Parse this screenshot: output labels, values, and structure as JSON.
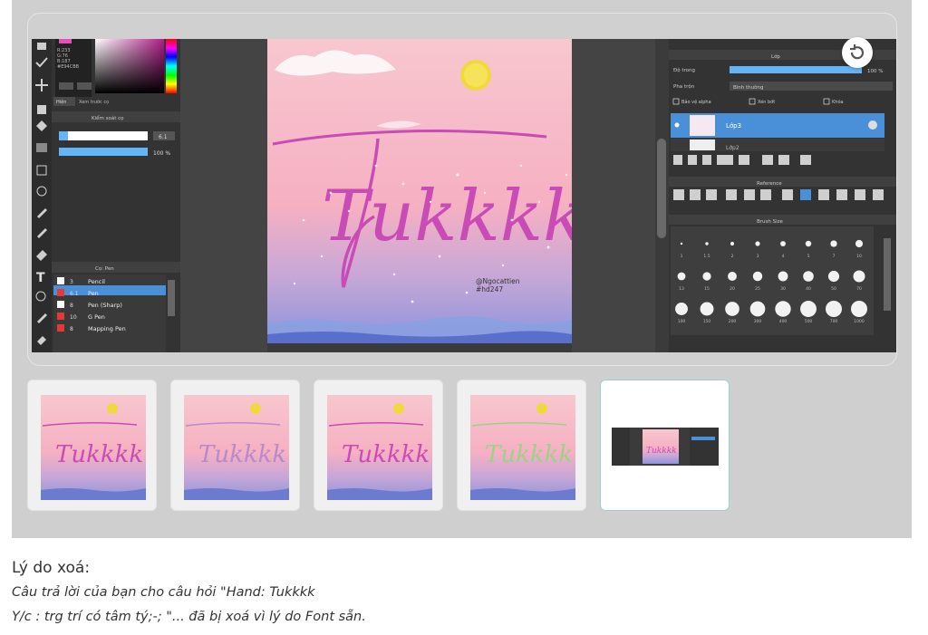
{
  "app": {
    "toolbox": {
      "color_values": [
        "R:233",
        "G:76",
        "B:187",
        "#E94CBB"
      ],
      "preview_tab": "Hiện",
      "preview_label": "Xem trước cọ"
    },
    "brush_control": {
      "panel_title": "Kiểm soát cọ",
      "size_value": "6.1",
      "opacity_value": "100 %"
    },
    "pen_list": {
      "panel_title": "Cọ: Pen",
      "items": [
        {
          "num": "3",
          "name": "Pencil",
          "color": "#ffffff"
        },
        {
          "num": "6.1",
          "name": "Pen",
          "color": "#e53935"
        },
        {
          "num": "8",
          "name": "Pen (Sharp)",
          "color": "#ffffff"
        },
        {
          "num": "10",
          "name": "G Pen",
          "color": "#e53935"
        },
        {
          "num": "8",
          "name": "Mapping Pen",
          "color": "#e53935"
        }
      ]
    },
    "canvas": {
      "lettering": "Tukkkk",
      "watermark_line1": "@Ngocattien",
      "watermark_line2": "#hd247"
    },
    "layers": {
      "panel_title": "Lớp",
      "opacity_label": "Độ trong",
      "opacity_value": "100 %",
      "blend_label": "Pha trộn",
      "blend_value": "Bình thường",
      "check_protect": "Bảo vệ alpha",
      "check_clip": "Xén bớt",
      "check_lock": "Khóa",
      "layer_selected": "Lớp3",
      "layer_next": "Lớp2"
    },
    "reference": {
      "panel_title": "Reference"
    },
    "brush_size": {
      "panel_title": "Brush Size",
      "sizes": [
        "1",
        "1.5",
        "2",
        "3",
        "4",
        "5",
        "7",
        "10",
        "13",
        "15",
        "20",
        "25",
        "30",
        "40",
        "50",
        "70",
        "100",
        "150",
        "200",
        "300",
        "400",
        "500",
        "700",
        "1000"
      ]
    }
  },
  "caption": {
    "heading": "Lý do xoá:",
    "line1": "Câu trả lời của bạn cho câu hỏi \"Hand: Tukkkk",
    "line2": "Y/c : trg trí có tâm tý;-; \"... đã bị xoá vì lý do Font sẵn."
  },
  "colors": {
    "accent": "#1e88e5",
    "lettering": "#c94bb5",
    "sky_pink": "#f6b9c8",
    "sea_blue": "#7d86d4"
  }
}
